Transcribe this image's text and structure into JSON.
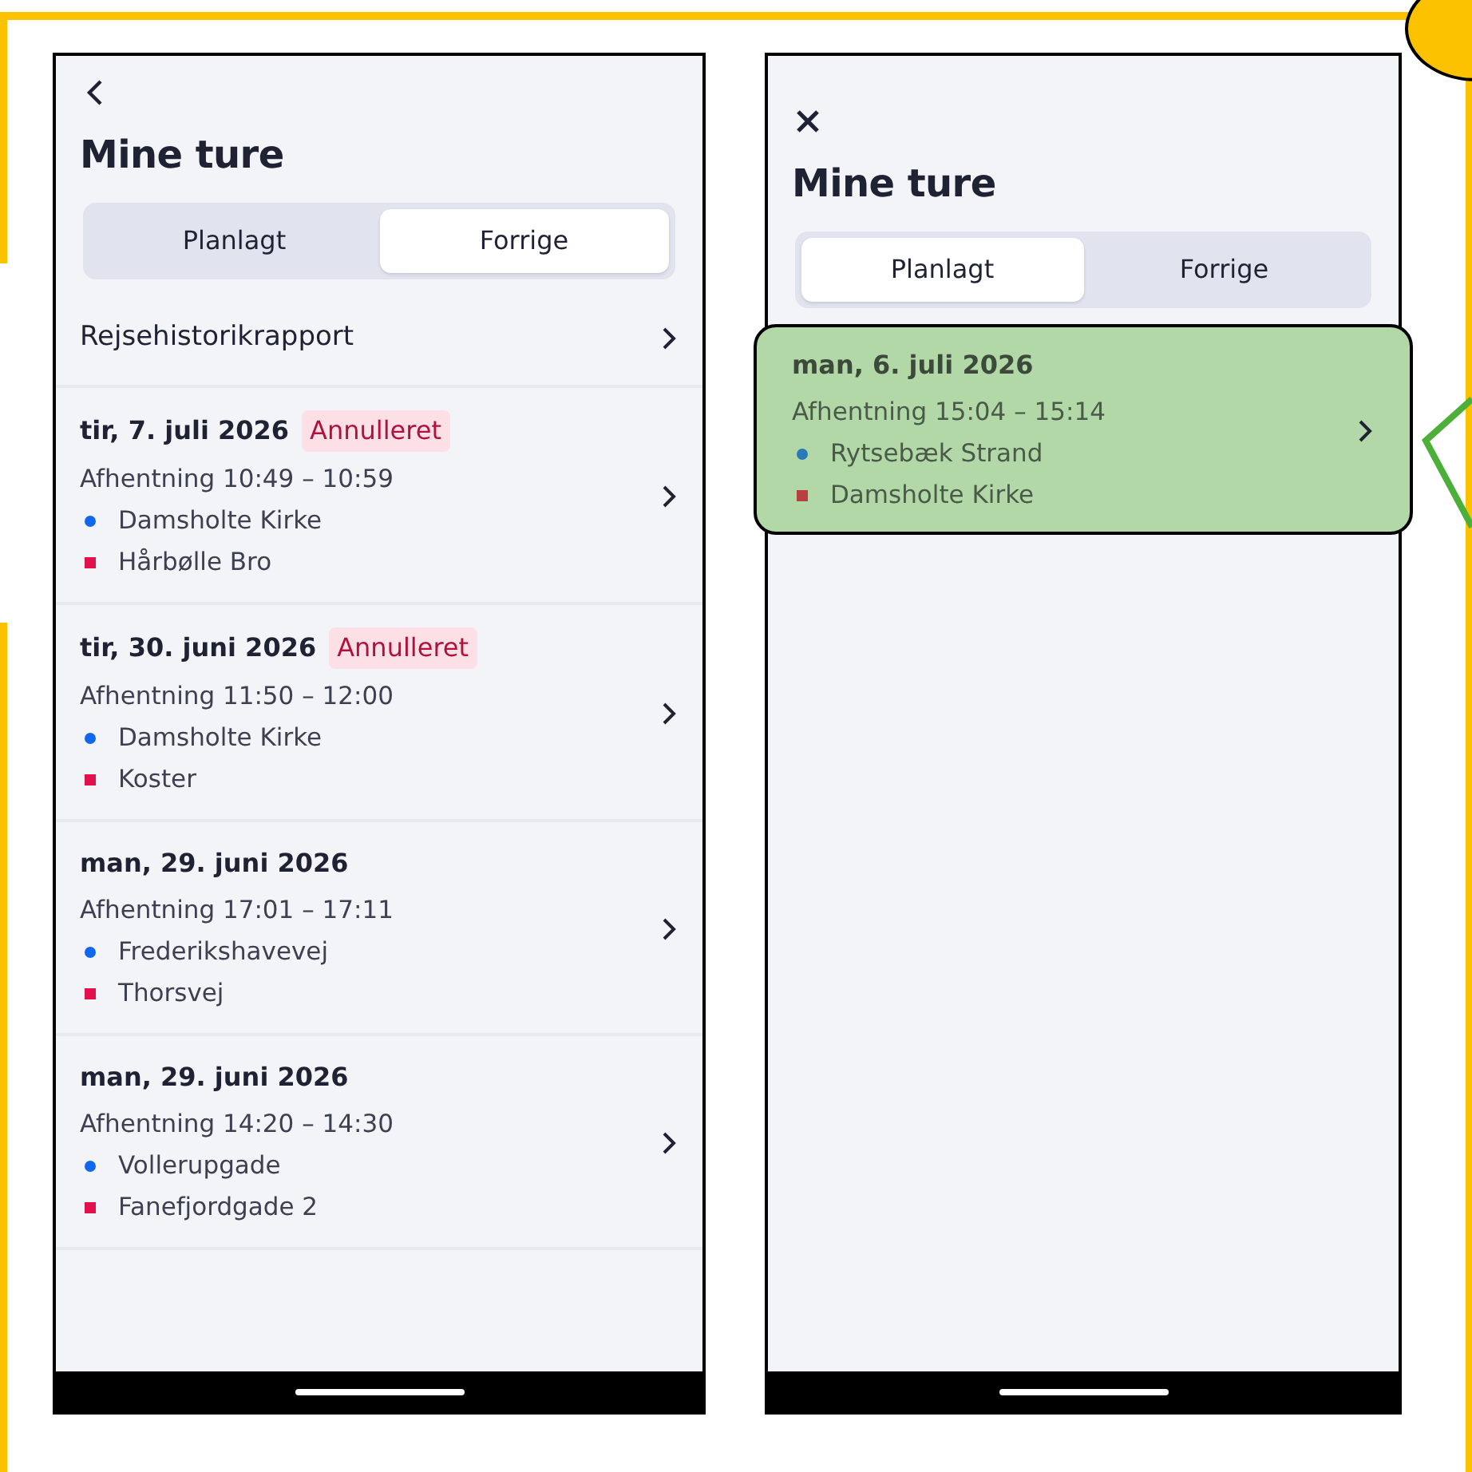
{
  "screens": [
    {
      "nav": {
        "kind": "back"
      },
      "title": "Mine ture",
      "tabs": [
        {
          "label": "Planlagt",
          "selected": false
        },
        {
          "label": "Forrige",
          "selected": true
        }
      ],
      "report_link": {
        "label": "Rejsehistorikrapport"
      },
      "trips": [
        {
          "date": "tir, 7. juli 2026",
          "status": "Annulleret",
          "pickup": "Afhentning 10:49 – 10:59",
          "highlighted": false,
          "stops": [
            {
              "kind": "pickup",
              "name": "Damsholte Kirke"
            },
            {
              "kind": "dropoff",
              "name": "Hårbølle Bro"
            }
          ]
        },
        {
          "date": "tir, 30. juni 2026",
          "status": "Annulleret",
          "pickup": "Afhentning 11:50 – 12:00",
          "highlighted": false,
          "stops": [
            {
              "kind": "pickup",
              "name": "Damsholte Kirke"
            },
            {
              "kind": "dropoff",
              "name": "Koster"
            }
          ]
        },
        {
          "date": "man, 29. juni 2026",
          "pickup": "Afhentning 17:01 – 17:11",
          "highlighted": false,
          "stops": [
            {
              "kind": "pickup",
              "name": "Frederikshavevej"
            },
            {
              "kind": "dropoff",
              "name": "Thorsvej"
            }
          ]
        },
        {
          "date": "man, 29. juni 2026",
          "pickup": "Afhentning 14:20 – 14:30",
          "highlighted": false,
          "stops": [
            {
              "kind": "pickup",
              "name": "Vollerupgade"
            },
            {
              "kind": "dropoff",
              "name": "Fanefjordgade 2"
            }
          ]
        }
      ]
    },
    {
      "nav": {
        "kind": "close"
      },
      "title": "Mine ture",
      "tabs": [
        {
          "label": "Planlagt",
          "selected": true
        },
        {
          "label": "Forrige",
          "selected": false
        }
      ],
      "trips": [
        {
          "date": "man, 6. juli 2026",
          "pickup": "Afhentning 15:04 – 15:14",
          "highlighted": true,
          "stops": [
            {
              "kind": "pickup",
              "name": "Rytsebæk Strand"
            },
            {
              "kind": "dropoff",
              "name": "Damsholte Kirke"
            }
          ]
        }
      ]
    }
  ]
}
